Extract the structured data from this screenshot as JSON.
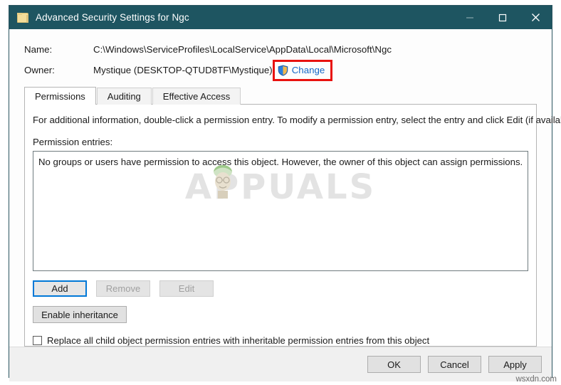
{
  "window": {
    "title": "Advanced Security Settings for Ngc",
    "icon": "folder-icon",
    "controls": {
      "minimize": "minimize-icon",
      "maximize": "maximize-icon",
      "close": "close-icon"
    }
  },
  "info": {
    "name_label": "Name:",
    "name_value": "C:\\Windows\\ServiceProfiles\\LocalService\\AppData\\Local\\Microsoft\\Ngc",
    "owner_label": "Owner:",
    "owner_value": "Mystique (DESKTOP-QTUD8TF\\Mystique)",
    "change_link": "Change",
    "change_icon": "uac-shield-icon"
  },
  "tabs": [
    {
      "label": "Permissions",
      "active": true
    },
    {
      "label": "Auditing",
      "active": false
    },
    {
      "label": "Effective Access",
      "active": false
    }
  ],
  "panel": {
    "instruction": "For additional information, double-click a permission entry. To modify a permission entry, select the entry and click Edit (if available).",
    "entries_label": "Permission entries:",
    "list_message": "No groups or users have permission to access this object. However, the owner of this object can assign permissions.",
    "watermark": "APPUALS"
  },
  "buttons": {
    "add": "Add",
    "remove": "Remove",
    "edit": "Edit",
    "enable_inheritance": "Enable inheritance"
  },
  "checkbox": {
    "label": "Replace all child object permission entries with inheritable permission entries from this object",
    "checked": false
  },
  "footer": {
    "ok": "OK",
    "cancel": "Cancel",
    "apply": "Apply"
  },
  "page_watermark": "wsxdn.com",
  "colors": {
    "titlebar": "#1e5561",
    "link": "#1567c7",
    "highlight_box": "#e8120f",
    "focus": "#0078d7"
  }
}
